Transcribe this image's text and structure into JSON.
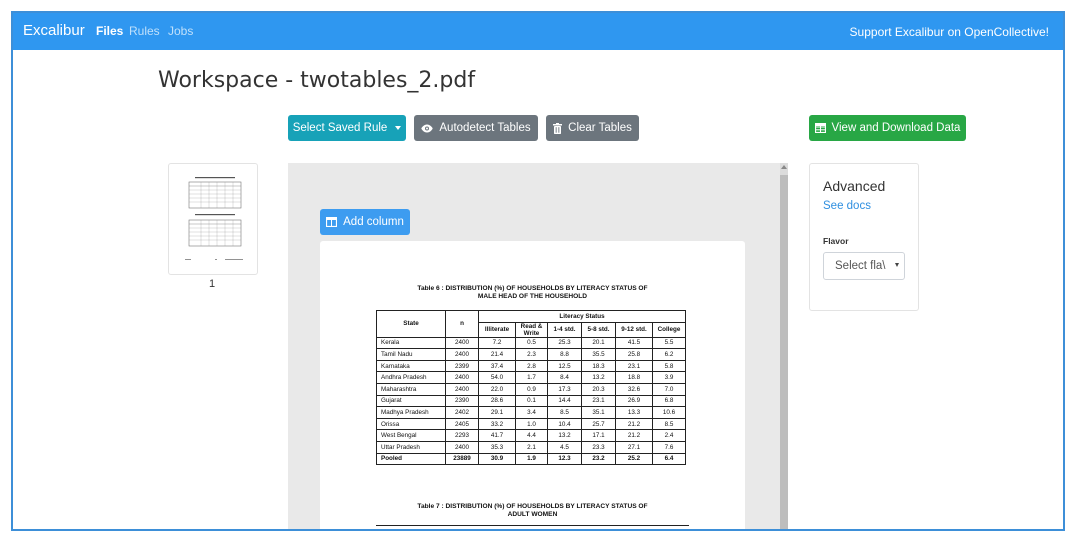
{
  "navbar": {
    "brand": "Excalibur",
    "links": [
      {
        "label": "Files"
      },
      {
        "label": "Rules"
      },
      {
        "label": "Jobs"
      }
    ],
    "support": "Support Excalibur on OpenCollective!"
  },
  "workspace": {
    "title": "Workspace - twotables_2.pdf"
  },
  "toolbar": {
    "select_rule": "Select Saved Rule",
    "autodetect": "Autodetect Tables",
    "clear": "Clear Tables",
    "view_download": "View and Download Data"
  },
  "thumbnail": {
    "page_number": "1"
  },
  "viewer": {
    "add_column": "Add column"
  },
  "document": {
    "table6_caption_line1": "Table 6 : DISTRIBUTION (%) OF HOUSEHOLDS BY LITERACY STATUS OF",
    "table6_caption_line2": "MALE HEAD OF THE HOUSEHOLD",
    "headers": {
      "state": "State",
      "n": "n",
      "group": "Literacy Status",
      "illiterate": "Illiterate",
      "read_write": "Read &",
      "read_write2": "Write",
      "c14": "1-4 std.",
      "c58": "5-8 std.",
      "c912": "9-12 std.",
      "college": "College"
    },
    "rows": [
      [
        "Kerala",
        "2400",
        "7.2",
        "0.5",
        "25.3",
        "20.1",
        "41.5",
        "5.5"
      ],
      [
        "Tamil Nadu",
        "2400",
        "21.4",
        "2.3",
        "8.8",
        "35.5",
        "25.8",
        "6.2"
      ],
      [
        "Karnataka",
        "2399",
        "37.4",
        "2.8",
        "12.5",
        "18.3",
        "23.1",
        "5.8"
      ],
      [
        "Andhra Pradesh",
        "2400",
        "54.0",
        "1.7",
        "8.4",
        "13.2",
        "18.8",
        "3.9"
      ],
      [
        "Maharashtra",
        "2400",
        "22.0",
        "0.9",
        "17.3",
        "20.3",
        "32.6",
        "7.0"
      ],
      [
        "Gujarat",
        "2390",
        "28.6",
        "0.1",
        "14.4",
        "23.1",
        "26.9",
        "6.8"
      ],
      [
        "Madhya Pradesh",
        "2402",
        "29.1",
        "3.4",
        "8.5",
        "35.1",
        "13.3",
        "10.6"
      ],
      [
        "Orissa",
        "2405",
        "33.2",
        "1.0",
        "10.4",
        "25.7",
        "21.2",
        "8.5"
      ],
      [
        "West Bengal",
        "2293",
        "41.7",
        "4.4",
        "13.2",
        "17.1",
        "21.2",
        "2.4"
      ],
      [
        "Uttar Pradesh",
        "2400",
        "35.3",
        "2.1",
        "4.5",
        "23.3",
        "27.1",
        "7.6"
      ]
    ],
    "pooled": [
      "Pooled",
      "23889",
      "30.9",
      "1.9",
      "12.3",
      "23.2",
      "25.2",
      "6.4"
    ],
    "table7_caption_line1": "Table 7 : DISTRIBUTION (%) OF HOUSEHOLDS BY LITERACY STATUS OF",
    "table7_caption_line2": "ADULT WOMEN"
  },
  "advanced": {
    "title": "Advanced",
    "see_docs": "See docs",
    "flavor_label": "Flavor",
    "flavor_placeholder": "Select fla\\"
  }
}
